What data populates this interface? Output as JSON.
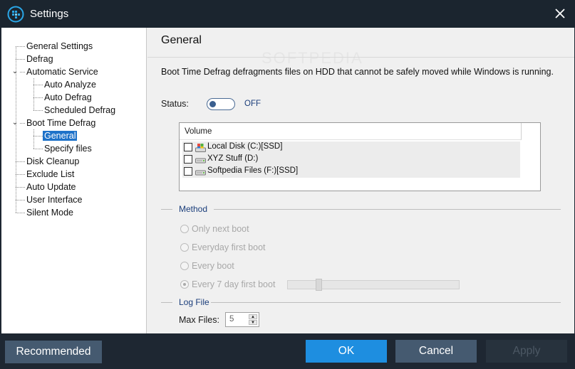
{
  "window": {
    "title": "Settings",
    "app_icon": "defrag-app-icon",
    "close_icon": "close-icon"
  },
  "tree": {
    "items": [
      {
        "label": "General Settings",
        "level": 0,
        "expandable": false
      },
      {
        "label": "Defrag",
        "level": 0,
        "expandable": false
      },
      {
        "label": "Automatic Service",
        "level": 0,
        "expandable": true,
        "expanded": true
      },
      {
        "label": "Auto Analyze",
        "level": 1
      },
      {
        "label": "Auto Defrag",
        "level": 1
      },
      {
        "label": "Scheduled Defrag",
        "level": 1
      },
      {
        "label": "Boot Time Defrag",
        "level": 0,
        "expandable": true,
        "expanded": true
      },
      {
        "label": "General",
        "level": 1,
        "selected": true
      },
      {
        "label": "Specify files",
        "level": 1
      },
      {
        "label": "Disk Cleanup",
        "level": 0
      },
      {
        "label": "Exclude List",
        "level": 0
      },
      {
        "label": "Auto Update",
        "level": 0
      },
      {
        "label": "User Interface",
        "level": 0
      },
      {
        "label": "Silent Mode",
        "level": 0
      }
    ]
  },
  "content": {
    "heading": "General",
    "watermark": "SOFTPEDIA",
    "description": "Boot Time Defrag defragments files on HDD that cannot be safely moved while Windows is running.",
    "status": {
      "label": "Status:",
      "state": "OFF",
      "enabled": false
    },
    "volumes": {
      "column_header": "Volume",
      "rows": [
        {
          "name": "Local Disk (C:)[SSD]",
          "checked": false,
          "icon": "system-drive-icon"
        },
        {
          "name": "XYZ Stuff (D:)",
          "checked": false,
          "icon": "hard-drive-icon"
        },
        {
          "name": "Softpedia Files (F:)[SSD]",
          "checked": false,
          "icon": "hard-drive-icon"
        }
      ]
    },
    "method": {
      "title": "Method",
      "options": [
        {
          "label": "Only next boot",
          "checked": false
        },
        {
          "label": "Everyday first boot",
          "checked": false
        },
        {
          "label": "Every boot",
          "checked": false
        },
        {
          "label": "Every 7 day first boot",
          "checked": true
        }
      ],
      "disabled": true,
      "days_slider_fraction": 0.17
    },
    "log_file": {
      "title": "Log File",
      "max_files_label": "Max Files:",
      "max_files_value": "5"
    }
  },
  "buttons": {
    "recommended": "Recommended",
    "ok": "OK",
    "cancel": "Cancel",
    "apply": "Apply"
  },
  "colors": {
    "accent": "#1e8ee0",
    "titlebar": "#1b252f",
    "selection": "#1e72c9",
    "secondary_button": "#455a70"
  }
}
